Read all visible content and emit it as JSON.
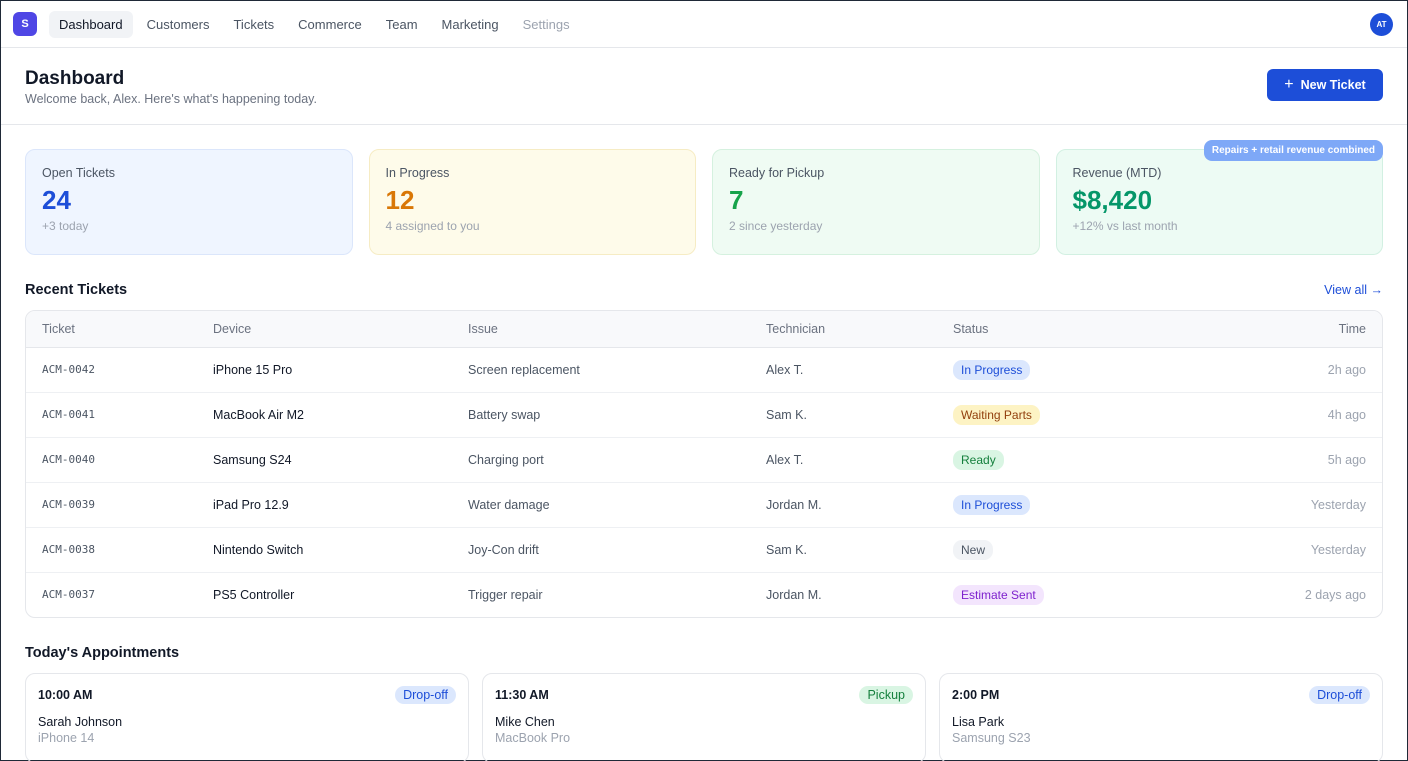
{
  "nav": {
    "brand": "S",
    "tabs": [
      {
        "label": "Dashboard"
      },
      {
        "label": "Customers"
      },
      {
        "label": "Tickets"
      },
      {
        "label": "Commerce"
      },
      {
        "label": "Team"
      },
      {
        "label": "Marketing"
      },
      {
        "label": "Settings"
      }
    ],
    "avatar": "AT"
  },
  "header": {
    "title": "Dashboard",
    "subtitle": "Welcome back, Alex. Here's what's happening today.",
    "new_ticket_label": "New Ticket",
    "new_ticket_icon": "+"
  },
  "stats": [
    {
      "label": "Open Tickets",
      "value": "24",
      "sub": "+3 today"
    },
    {
      "label": "In Progress",
      "value": "12",
      "sub": "4 assigned to you"
    },
    {
      "label": "Ready for Pickup",
      "value": "7",
      "sub": "2 since yesterday"
    },
    {
      "label": "Revenue (MTD)",
      "value": "$8,420",
      "sub": "+12% vs last month",
      "tooltip": "Repairs + retail revenue combined"
    }
  ],
  "recent": {
    "title": "Recent Tickets",
    "view_all": "View all →",
    "columns": [
      "Ticket",
      "Device",
      "Issue",
      "Technician",
      "Status",
      "Time"
    ],
    "rows": [
      {
        "ticket": "ACM-0042",
        "device": "iPhone 15 Pro",
        "issue": "Screen replacement",
        "tech": "Alex T.",
        "status": "In Progress",
        "time": "2h ago"
      },
      {
        "ticket": "ACM-0041",
        "device": "MacBook Air M2",
        "issue": "Battery swap",
        "tech": "Sam K.",
        "status": "Waiting Parts",
        "time": "4h ago"
      },
      {
        "ticket": "ACM-0040",
        "device": "Samsung S24",
        "issue": "Charging port",
        "tech": "Alex T.",
        "status": "Ready",
        "time": "5h ago"
      },
      {
        "ticket": "ACM-0039",
        "device": "iPad Pro 12.9",
        "issue": "Water damage",
        "tech": "Jordan M.",
        "status": "In Progress",
        "time": "Yesterday"
      },
      {
        "ticket": "ACM-0038",
        "device": "Nintendo Switch",
        "issue": "Joy-Con drift",
        "tech": "Sam K.",
        "status": "New",
        "time": "Yesterday"
      },
      {
        "ticket": "ACM-0037",
        "device": "PS5 Controller",
        "issue": "Trigger repair",
        "tech": "Jordan M.",
        "status": "Estimate Sent",
        "time": "2 days ago"
      }
    ]
  },
  "appointments": {
    "title": "Today's Appointments",
    "items": [
      {
        "time": "10:00 AM",
        "tag": "Drop-off",
        "name": "Sarah Johnson",
        "device": "iPhone 14"
      },
      {
        "time": "11:30 AM",
        "tag": "Pickup",
        "name": "Mike Chen",
        "device": "MacBook Pro"
      },
      {
        "time": "2:00 PM",
        "tag": "Drop-off",
        "name": "Lisa Park",
        "device": "Samsung S23"
      }
    ]
  },
  "colors": {
    "accent": "#1d4ed8",
    "brand": "#4f46e5",
    "open": "#1d4ed8",
    "progress": "#d97706",
    "ready": "#16a34a",
    "revenue": "#059669"
  }
}
